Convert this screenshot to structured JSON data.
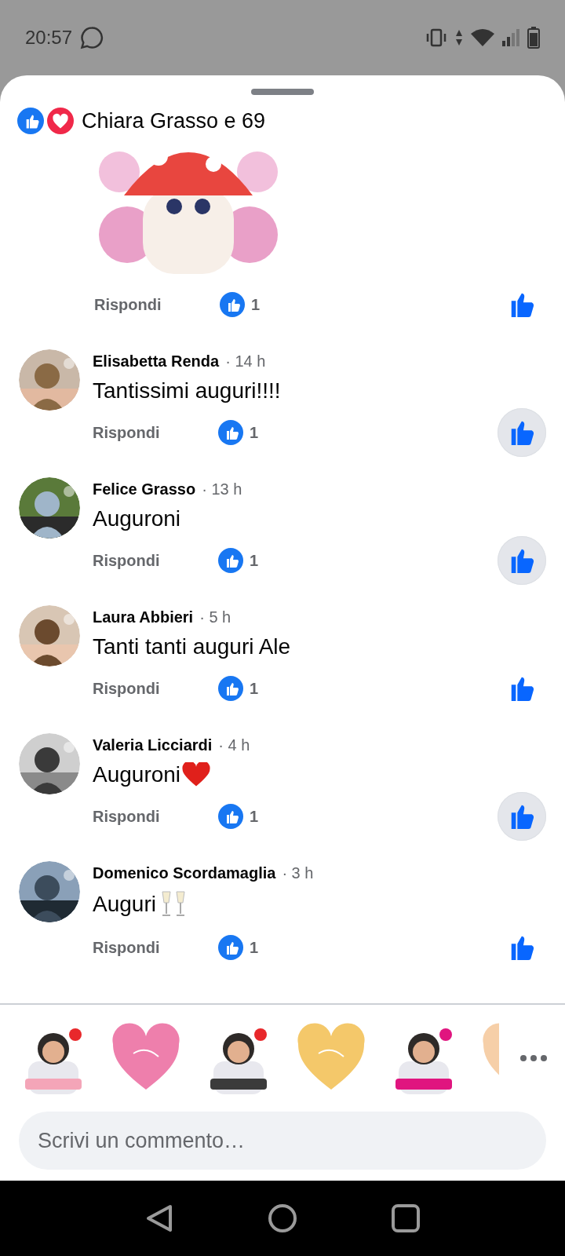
{
  "status_bar": {
    "time": "20:57"
  },
  "header": {
    "title": "Chiara Grasso e 69"
  },
  "comments": [
    {
      "kind": "sticker",
      "reply": "Rispondi",
      "likes": "1",
      "highlighted": false
    },
    {
      "kind": "text",
      "author": "Elisabetta Renda",
      "time": "· 14 h",
      "text": "Tantissimi auguri!!!!",
      "reply": "Rispondi",
      "likes": "1",
      "highlighted": true
    },
    {
      "kind": "text",
      "author": "Felice Grasso",
      "time": "· 13 h",
      "text": "Auguroni",
      "reply": "Rispondi",
      "likes": "1",
      "highlighted": true
    },
    {
      "kind": "text",
      "author": "Laura Abbieri",
      "time": "· 5 h",
      "text": "Tanti tanti auguri Ale",
      "reply": "Rispondi",
      "likes": "1",
      "highlighted": false
    },
    {
      "kind": "text",
      "author": "Valeria Licciardi",
      "time": "· 4 h",
      "text": "Auguroni",
      "icons": [
        {
          "kind": "heart"
        }
      ],
      "reply": "Rispondi",
      "likes": "1",
      "highlighted": true
    },
    {
      "kind": "text",
      "author": "Domenico Scordamaglia",
      "time": "· 3 h",
      "text": "Auguri",
      "icons": [
        {
          "kind": "glasses"
        }
      ],
      "reply": "Rispondi",
      "likes": "1",
      "highlighted": false
    }
  ],
  "composer": {
    "placeholder": "Scrivi un commento…"
  }
}
